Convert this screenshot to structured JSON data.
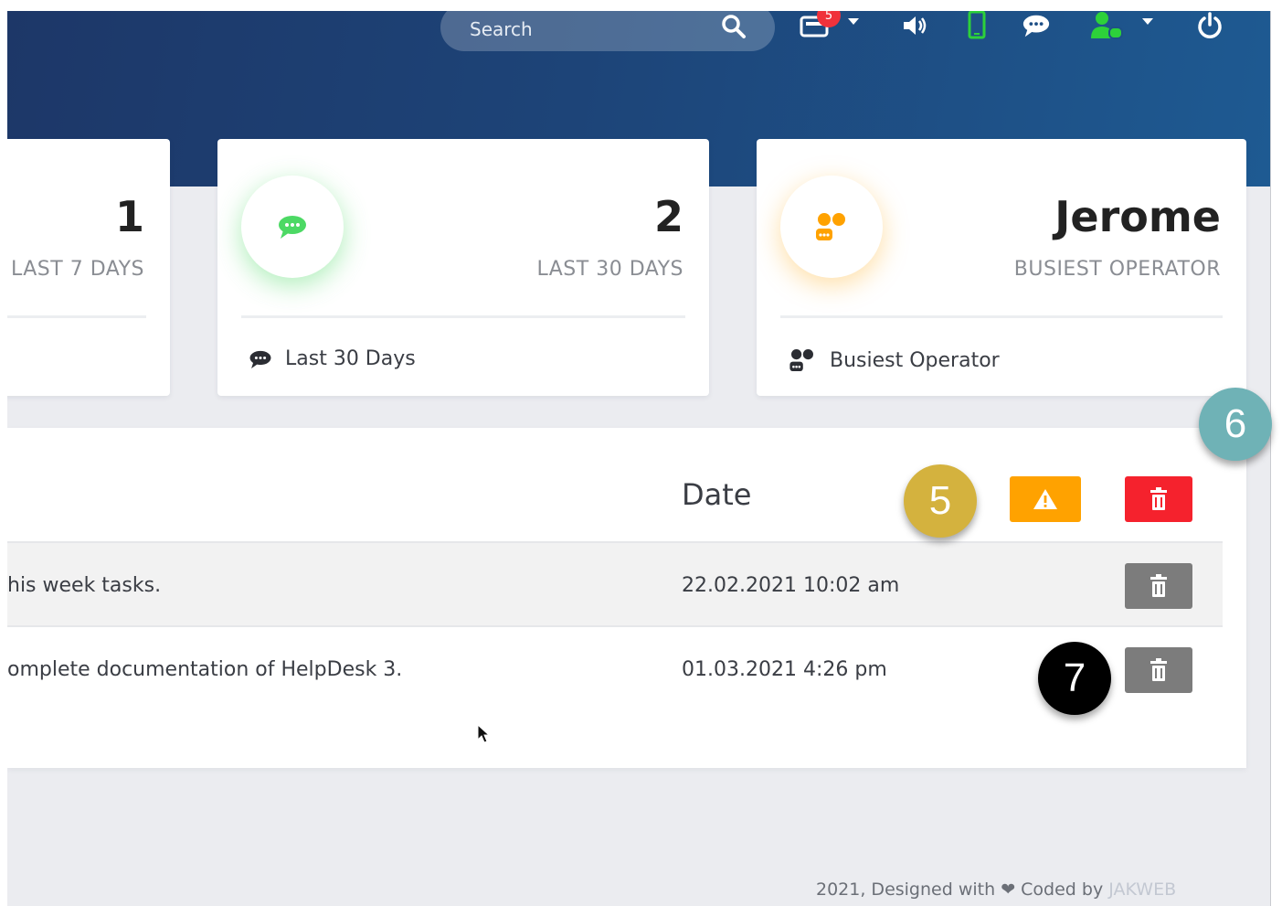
{
  "topbar": {
    "search_placeholder": "Search",
    "notification_count": "5"
  },
  "stats": [
    {
      "value": "1",
      "caption": "LAST 7 DAYS"
    },
    {
      "value": "2",
      "caption": "LAST 30 DAYS",
      "footer": "Last 30 Days",
      "accent": "#4cd964"
    },
    {
      "value": "Jerome",
      "caption": "BUSIEST OPERATOR",
      "footer": "Busiest Operator",
      "accent": "#ffa200"
    }
  ],
  "tasks": {
    "date_header": "Date",
    "rows": [
      {
        "text": "his week tasks.",
        "date": "22.02.2021 10:02 am"
      },
      {
        "text": "omplete documentation of HelpDesk 3.",
        "date": "01.03.2021 4:26 pm"
      }
    ]
  },
  "footer": {
    "text": "2021, Designed with",
    "coded_by": "Coded by",
    "brand": "JAKWEB"
  },
  "markers": [
    {
      "label": "5",
      "color": "#d4b23e"
    },
    {
      "label": "6",
      "color": "#6fb2b6"
    },
    {
      "label": "7",
      "color": "#000000"
    }
  ],
  "colors": {
    "warning": "#ffa200",
    "danger": "#f5222d",
    "delete_gray": "#7c7c7c"
  }
}
